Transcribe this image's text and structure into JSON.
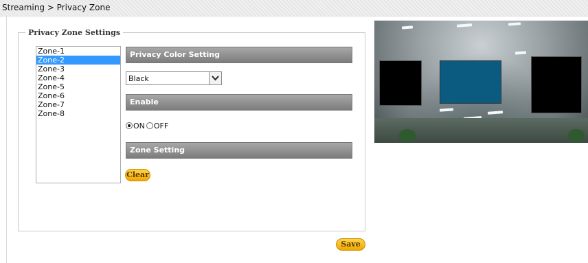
{
  "breadcrumb": "Streaming > Privacy Zone",
  "settings": {
    "legend": "Privacy Zone Settings",
    "zones": [
      "Zone-1",
      "Zone-2",
      "Zone-3",
      "Zone-4",
      "Zone-5",
      "Zone-6",
      "Zone-7",
      "Zone-8"
    ],
    "selected_zone": "Zone-2",
    "privacy_color_header": "Privacy Color Setting",
    "privacy_color_value": "Black",
    "enable_header": "Enable",
    "enable_on_label": "ON",
    "enable_off_label": "OFF",
    "enable_value": "ON",
    "zone_setting_header": "Zone Setting",
    "clear_label": "Clear"
  },
  "save_label": "Save",
  "colors": {
    "selection": "#3399ff",
    "section_bar": "#8a8a8a",
    "button": "#f5b800",
    "mask_black": "#000000",
    "mask_selected": "#0b5a80"
  }
}
